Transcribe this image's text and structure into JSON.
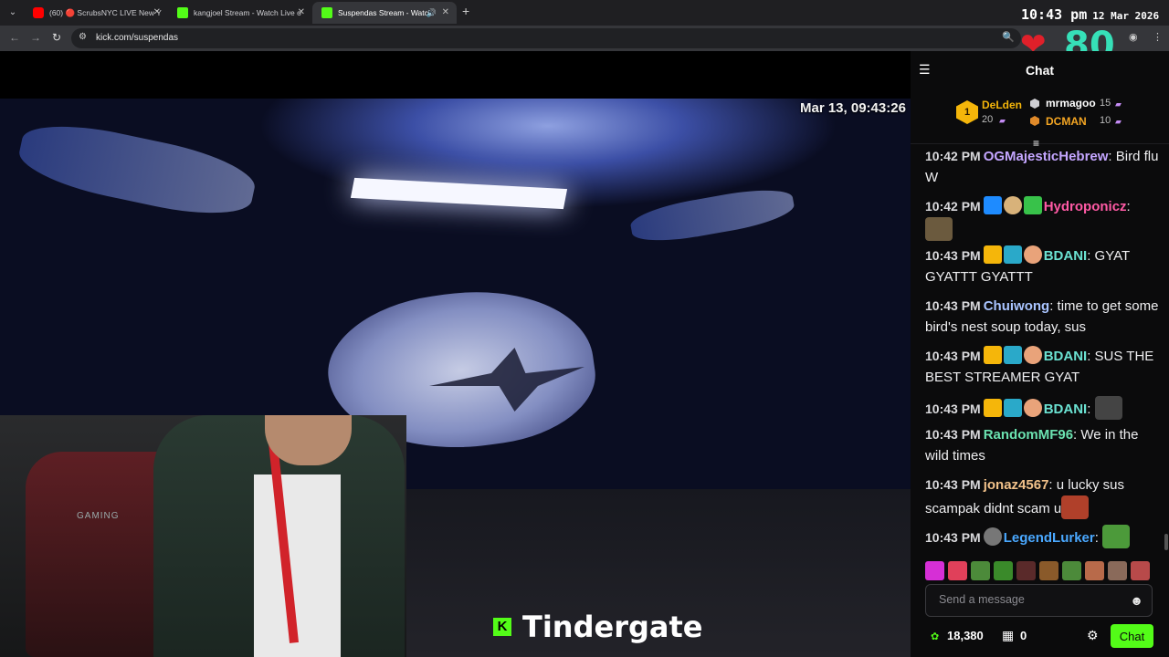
{
  "colors": {
    "kick_green": "#53fc18",
    "heart_red": "#e0202a",
    "hr_teal": "#36e0b8",
    "youtube_red": "#ff0000"
  },
  "browser": {
    "tabs": [
      {
        "title": "(60) 🔴 ScrubsNYC LIVE New Y",
        "favicon": "youtube-icon",
        "close": "✕"
      },
      {
        "title": "kangjoel Stream - Watch Live o",
        "favicon": "kick-icon",
        "close": "✕"
      },
      {
        "title": "Suspendas Stream - Watch",
        "favicon": "kick-icon",
        "close": "✕",
        "active": true
      }
    ],
    "new_tab": "+",
    "url": "kick.com/suspendas",
    "clock_time": "10:43 pm",
    "clock_date": "12 Mar 2026"
  },
  "overlay": {
    "heart": "❤",
    "heart_rate": "80"
  },
  "video": {
    "timestamp": "Mar 13, 09:43:26",
    "caption": "Tindergate",
    "kick_logo": "K",
    "chair_brand": "GAMING"
  },
  "chat": {
    "title": "Chat",
    "leaderboard": {
      "first": {
        "rank": "1",
        "name": "DeLden",
        "count": "20"
      },
      "second": {
        "name": "mrmagoo",
        "count": "15"
      },
      "third": {
        "name": "DCMAN",
        "count": "10"
      }
    },
    "messages": [
      {
        "time": "10:42 PM",
        "user": "OGMajesticHebrew",
        "color": "#c4a6ff",
        "text": "Bird flu W"
      },
      {
        "time": "10:42 PM",
        "user": "Hydroponicz",
        "color": "#ff5aa5",
        "text": ""
      },
      {
        "time": "10:43 PM",
        "user": "BDANI",
        "color": "#6be2d2",
        "text": "GYAT GYATTT GYATTT"
      },
      {
        "time": "10:43 PM",
        "user": "Chuiwong",
        "color": "#a9c4ff",
        "text": "time to get some bird's nest soup today, sus"
      },
      {
        "time": "10:43 PM",
        "user": "BDANI",
        "color": "#6be2d2",
        "text": "SUS THE BEST STREAMER GYAT"
      },
      {
        "time": "10:43 PM",
        "user": "BDANI",
        "color": "#6be2d2",
        "text": ""
      },
      {
        "time": "10:43 PM",
        "user": "RandomMF96",
        "color": "#6be2b0",
        "text": "We in the wild times"
      },
      {
        "time": "10:43 PM",
        "user": "jonaz4567",
        "color": "#f2c28a",
        "text": "u lucky sus scampak didnt scam u"
      },
      {
        "time": "10:43 PM",
        "user": "LegendLurker",
        "color": "#4aa8ff",
        "text": ""
      }
    ],
    "input_placeholder": "Send a message",
    "points": "18,380",
    "store_count": "0",
    "send_label": "Chat"
  }
}
